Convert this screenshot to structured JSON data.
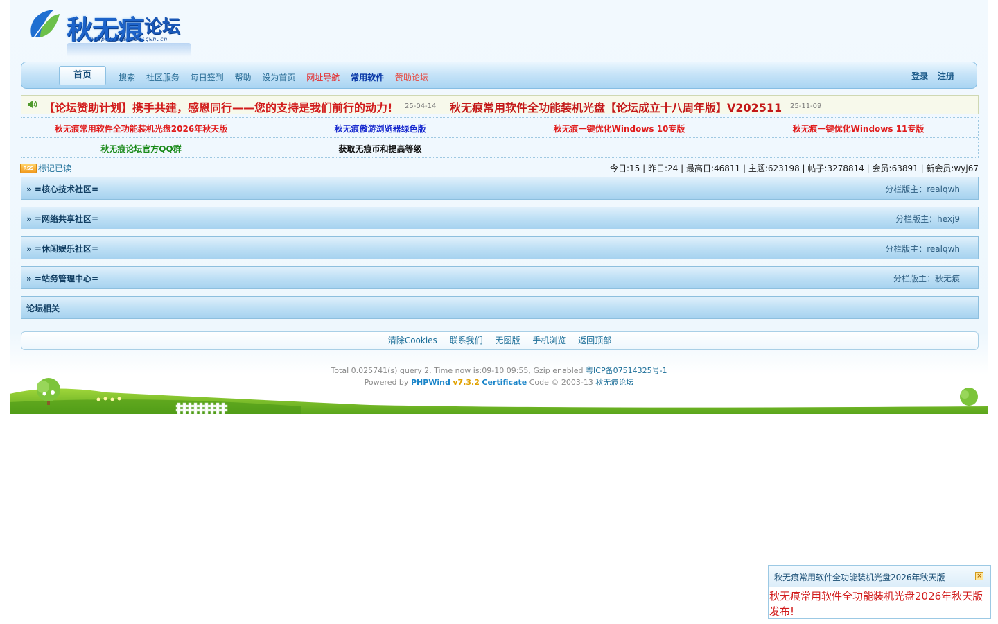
{
  "logo": {
    "name": "秋无痕",
    "suffix": "论坛",
    "url": "http://bbs.realqwh.cn"
  },
  "nav": {
    "home": "首页",
    "items": [
      {
        "label": "搜索",
        "style": "normal"
      },
      {
        "label": "社区服务",
        "style": "normal"
      },
      {
        "label": "每日签到",
        "style": "normal"
      },
      {
        "label": "帮助",
        "style": "normal"
      },
      {
        "label": "设为首页",
        "style": "normal"
      },
      {
        "label": "网址导航",
        "style": "red"
      },
      {
        "label": "常用软件",
        "style": "blue"
      },
      {
        "label": "赞助论坛",
        "style": "red2"
      }
    ],
    "login": "登录",
    "register": "注册"
  },
  "notice": {
    "item1": "【论坛赞助计划】携手共建，感恩同行——您的支持是我们前行的动力!",
    "date1": "25-04-14",
    "item2": "秋无痕常用软件全功能装机光盘【论坛成立十八周年版】V202511",
    "date2": "25-11-09"
  },
  "links": {
    "row1": [
      {
        "text": "秋无痕常用软件全功能装机光盘2026年秋天版",
        "color": "#e01c1c"
      },
      {
        "text": "秋无痕傲游浏览器绿色版",
        "color": "#1a2ccf"
      },
      {
        "text": "秋无痕一键优化Windows 10专版",
        "color": "#e01c1c"
      },
      {
        "text": "秋无痕一键优化Windows 11专版",
        "color": "#e01c1c"
      }
    ],
    "row2": [
      {
        "text": "秋无痕论坛官方QQ群",
        "color": "#1a8a1a"
      },
      {
        "text": "获取无痕币和提高等级",
        "color": "#111111"
      }
    ]
  },
  "stats": {
    "rss": "RSS",
    "mark_read": "标记已读",
    "text": "今日:15 | 昨日:24 | 最高日:46811 | 主题:623198 | 帖子:3278814 | 会员:63891 | 新会员:wyj67"
  },
  "categories": [
    {
      "title": "» =核心技术社区=",
      "mod": "分栏版主：realqwh"
    },
    {
      "title": "» =网络共享社区=",
      "mod": "分栏版主：hexj9"
    },
    {
      "title": "» =休闲娱乐社区=",
      "mod": "分栏版主：realqwh"
    },
    {
      "title": "» =站务管理中心=",
      "mod": "分栏版主：秋无痕"
    },
    {
      "title": "论坛相关",
      "mod": ""
    }
  ],
  "footer": {
    "links": [
      "清除Cookies",
      "联系我们",
      "无图版",
      "手机浏览",
      "返回顶部"
    ],
    "line1_text": "Total 0.025741(s) query 2, Time now is:09-10 09:55, Gzip enabled",
    "icp": "粤ICP备07514325号-1",
    "line2_prefix": "Powered by",
    "brand": "PHPWind",
    "version": "v7.3.2",
    "cert": "Certificate",
    "code_text": "Code © 2003-13",
    "site": "秋无痕论坛"
  },
  "popup": {
    "title": "秋无痕常用软件全功能装机光盘2026年秋天版",
    "body": "秋无痕常用软件全功能装机光盘2026年秋天版发布!",
    "close_icon": "close-icon"
  }
}
